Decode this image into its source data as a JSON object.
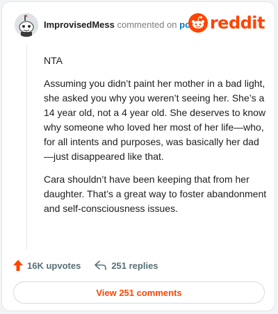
{
  "comment": {
    "author": "ImprovisedMess",
    "action": "commented on",
    "post_type": "post",
    "paragraphs": [
      "NTA",
      "Assuming you didn’t paint her mother in a bad light, she asked you why you weren’t seeing her. She’s a 14 year old, not a 4 year old. She deserves to know why someone who loved her most of her life—who, for all intents and purposes, was basically her dad—just disappeared like that.",
      "Cara shouldn’t have been keeping that from her daughter. That’s a great way to foster abandonment and self-consciousness issues."
    ]
  },
  "brand": {
    "wordmark": "reddit",
    "icon": "reddit-snoo-icon",
    "color": "#ff4500"
  },
  "footer": {
    "upvotes": "16K upvotes",
    "upvote_icon": "upvote-arrow-icon",
    "replies": "251 replies",
    "reply_icon": "reply-arrow-icon",
    "view_button": "View 251 comments"
  },
  "colors": {
    "accent": "#ff4500",
    "link": "#0079d3",
    "muted": "#7c7c7c",
    "meta": "#576f76"
  }
}
